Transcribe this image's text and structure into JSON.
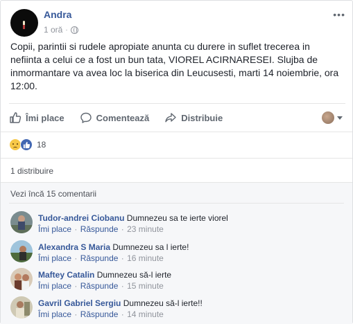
{
  "post": {
    "author": "Andra",
    "time": "1 oră",
    "dot": "·",
    "more": "•••",
    "text": "Copii, parintii si rudele apropiate anunta cu durere in suflet trecerea in nefiinta a celui ce a fost un bun tata, VIOREL ACIRNARESEI. Slujba de inmormantare va avea loc la biserica din Leucusesti, marti 14 noiembrie, ora 12:00."
  },
  "actions": {
    "like": "Îmi place",
    "comment": "Comentează",
    "share": "Distribuie"
  },
  "reactions": {
    "count": "18"
  },
  "shares": "1 distribuire",
  "view_more": "Vezi încă 15 comentarii",
  "comment_labels": {
    "like": "Îmi place",
    "reply": "Răspunde",
    "separator": "·"
  },
  "comments": [
    {
      "name": "Tudor-andrei Ciobanu",
      "text": "Dumnezeu sa te ierte viorel",
      "time": "23 minute"
    },
    {
      "name": "Alexandra S Maria",
      "text": "Dumnezeu sa l ierte!",
      "time": "16 minute"
    },
    {
      "name": "Maftey Catalin",
      "text": "Dumnezeu să-l ierte",
      "time": "15 minute"
    },
    {
      "name": "Gavril Gabriel Sergiu",
      "text": "Dumnezeu să-l ierte!!",
      "time": "14 minute"
    }
  ],
  "colors": {
    "link": "#365899",
    "like_blue": "#4267b2",
    "muted": "#90949c",
    "comments_bg": "#f6f7f9"
  }
}
